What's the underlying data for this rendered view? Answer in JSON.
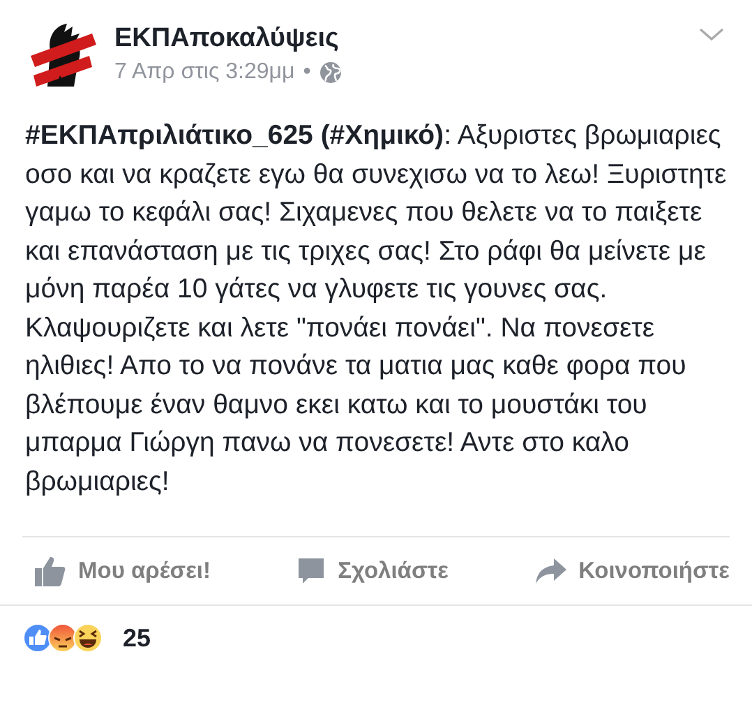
{
  "post": {
    "author": "ΕΚΠΑποκαλύψεις",
    "timestamp": "7 Απρ στις 3:29μμ",
    "separator": "•",
    "text": "**#ΕΚΠΑπριλιάτικο_625 (#Χημικό)**: Αξυριστες βρωμιαριες οσο και να κραζετε εγω θα συνεχισω να το λεω! Ξυριστητε γαμω το κεφάλι σας! Σιχαμενες που θελετε να το παιξετε και επανάσταση με τις τριχες σας! Στο ράφι θα μείνετε με μόνη παρέα 10 γάτες να γλυφετε τις γουνες σας. Κλαψουριζετε και λετε \"πονάει πονάει\". Να πονεσετε ηλιθιες! Απο το να πονάνε τα ματια μας καθε φορα που βλέπουμε έναν θαμνο εκει κατω και το μουστάκι του μπαρμα Γιώργη πανω να πονεσετε! Αντε στο καλο βρωμιαριες!"
  },
  "actions": [
    {
      "kind": "like",
      "label": "Μου αρέσει!"
    },
    {
      "kind": "comment",
      "label": "Σχολιάστε"
    },
    {
      "kind": "share",
      "label": "Κοινοποιήστε"
    }
  ],
  "reactions": {
    "icons": [
      {
        "kind": "like"
      },
      {
        "kind": "angry"
      },
      {
        "kind": "haha"
      }
    ],
    "count": "25"
  }
}
